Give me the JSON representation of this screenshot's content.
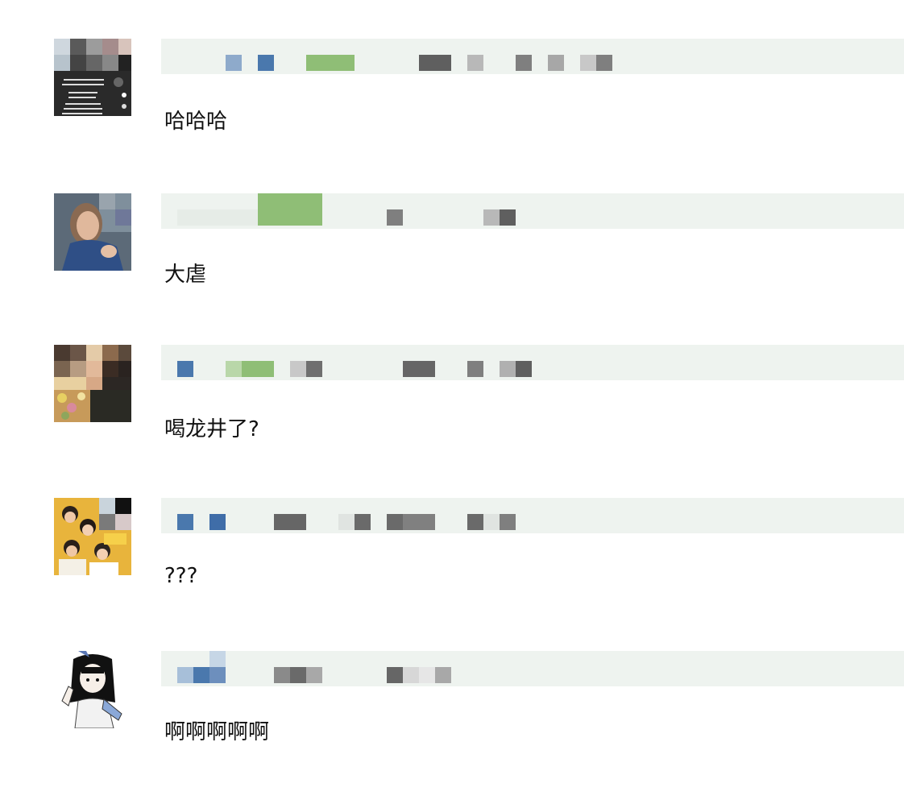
{
  "comments": [
    {
      "text": "哈哈哈"
    },
    {
      "text": "大虐"
    },
    {
      "text": "喝龙井了?"
    },
    {
      "text": "???"
    },
    {
      "text": "啊啊啊啊啊"
    }
  ],
  "colors": {
    "name_bar_bg": "#eef3ef",
    "text": "#111111",
    "blue": "#4a78ad",
    "light_blue": "#8eaacb",
    "green": "#8fbe76",
    "gray": "#7f7f7f",
    "dark_gray": "#5f5f5f",
    "light_gray": "#b8b8b8"
  },
  "icons": {
    "avatar_1": "phone-screenshot-avatar",
    "avatar_2": "woman-portrait-avatar",
    "avatar_3": "flowers-portrait-avatar",
    "avatar_4": "group-photo-avatar",
    "avatar_5": "anime-girl-avatar"
  }
}
